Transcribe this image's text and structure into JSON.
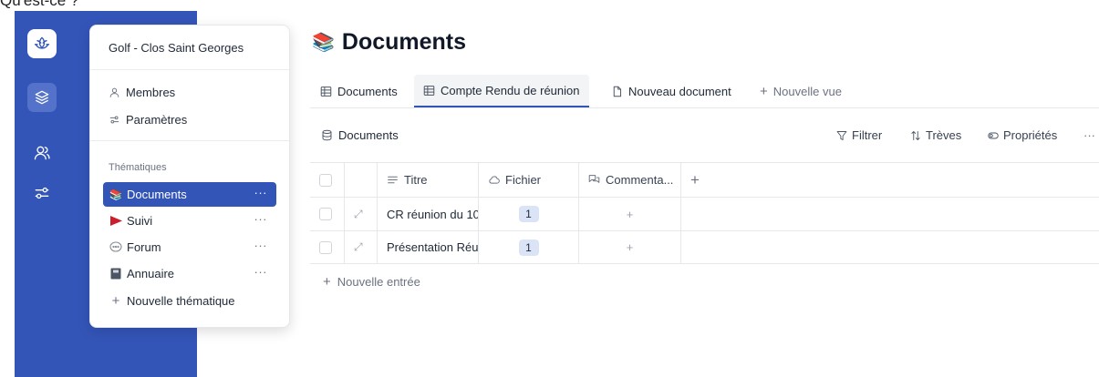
{
  "top_fragment": "Qu'est-ce ?",
  "workspace": {
    "name": "Golf - Clos Saint Georges"
  },
  "menu": {
    "membres": "Membres",
    "parametres": "Paramètres",
    "section_title": "Thématiques",
    "items": [
      {
        "label": "Documents",
        "icon": "books-icon",
        "glyph": "📚",
        "more": "···"
      },
      {
        "label": "Suivi",
        "icon": "red-flag-icon",
        "glyph": "🚩",
        "more": "···"
      },
      {
        "label": "Forum",
        "icon": "speech-bubble-icon",
        "glyph": "💬",
        "more": "···"
      },
      {
        "label": "Annuaire",
        "icon": "address-book-icon",
        "glyph": "📓",
        "more": "···"
      }
    ],
    "add_label": "Nouvelle thématique",
    "add_glyph": "+"
  },
  "page": {
    "title": "Documents",
    "title_glyph": "📚"
  },
  "tabs": [
    {
      "label": "Documents"
    },
    {
      "label": "Compte Rendu de réunion"
    },
    {
      "label": "Nouveau document"
    },
    {
      "label": "Nouvelle vue",
      "glyph": "+"
    }
  ],
  "toolbar": {
    "view_label": "Documents",
    "filter": "Filtrer",
    "sort": "Trèves",
    "properties": "Propriétés",
    "more": "···"
  },
  "table": {
    "columns": [
      "Titre",
      "Fichier",
      "Commenta...",
      "+"
    ],
    "rows": [
      {
        "title": "CR réunion du 10",
        "fichier": "1",
        "commentaires": "+"
      },
      {
        "title": "Présentation Réu",
        "fichier": "1",
        "commentaires": "+"
      }
    ],
    "expand_glyph": "⤢",
    "new_entry": "Nouvelle entrée",
    "new_entry_glyph": "+"
  },
  "colors": {
    "rail": "#3455b8",
    "accent": "#3455b8",
    "badge": "#dbe4f7",
    "flag": "#cc1f2d"
  }
}
